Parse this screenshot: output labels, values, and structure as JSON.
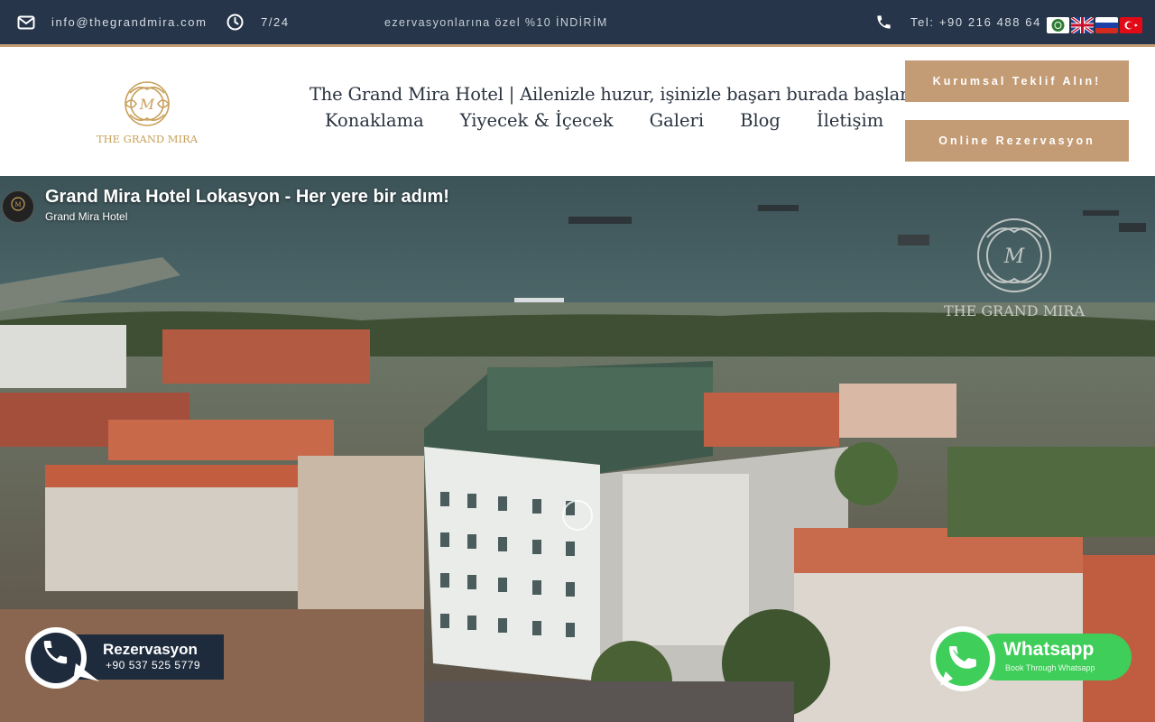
{
  "topbar": {
    "email": "info@thegrandmira.com",
    "hours": "7/24",
    "promo": "ezervasyonlarına özel %10 İNDİRİM",
    "phone": "Tel: +90 216 488 64 7",
    "icons": [
      "envelope-icon",
      "clock-icon",
      "phone-icon"
    ],
    "flags": [
      "arabic-flag",
      "english-flag",
      "russian-flag",
      "turkish-flag"
    ]
  },
  "header": {
    "logo_text": "THE GRAND MIRA",
    "site_title": "The Grand Mira Hotel | Ailenizle huzur, işinizle başarı burada başlar",
    "nav": [
      "Konaklama",
      "Yiyecek & İçecek",
      "Galeri",
      "Blog",
      "İletişim"
    ],
    "btn_corporate": "Kurumsal Teklif Alın!",
    "btn_online": "Online Rezervasyon"
  },
  "video": {
    "title": "Grand Mira Hotel Lokasyon - Her yere bir adım!",
    "channel": "Grand Mira Hotel",
    "watermark_text": "THE GRAND MIRA"
  },
  "floating": {
    "rez_label": "Rezervasyon",
    "rez_phone": "+90 537 525 5779",
    "wa_label": "Whatsapp",
    "wa_sub": "Book Through Whatsapp"
  },
  "colors": {
    "topbar_bg": "#263549",
    "accent_gold": "#c39b74",
    "nav_text": "#2a3340",
    "whatsapp_green": "#3fce5a",
    "rez_navy": "#1e2b3d"
  }
}
